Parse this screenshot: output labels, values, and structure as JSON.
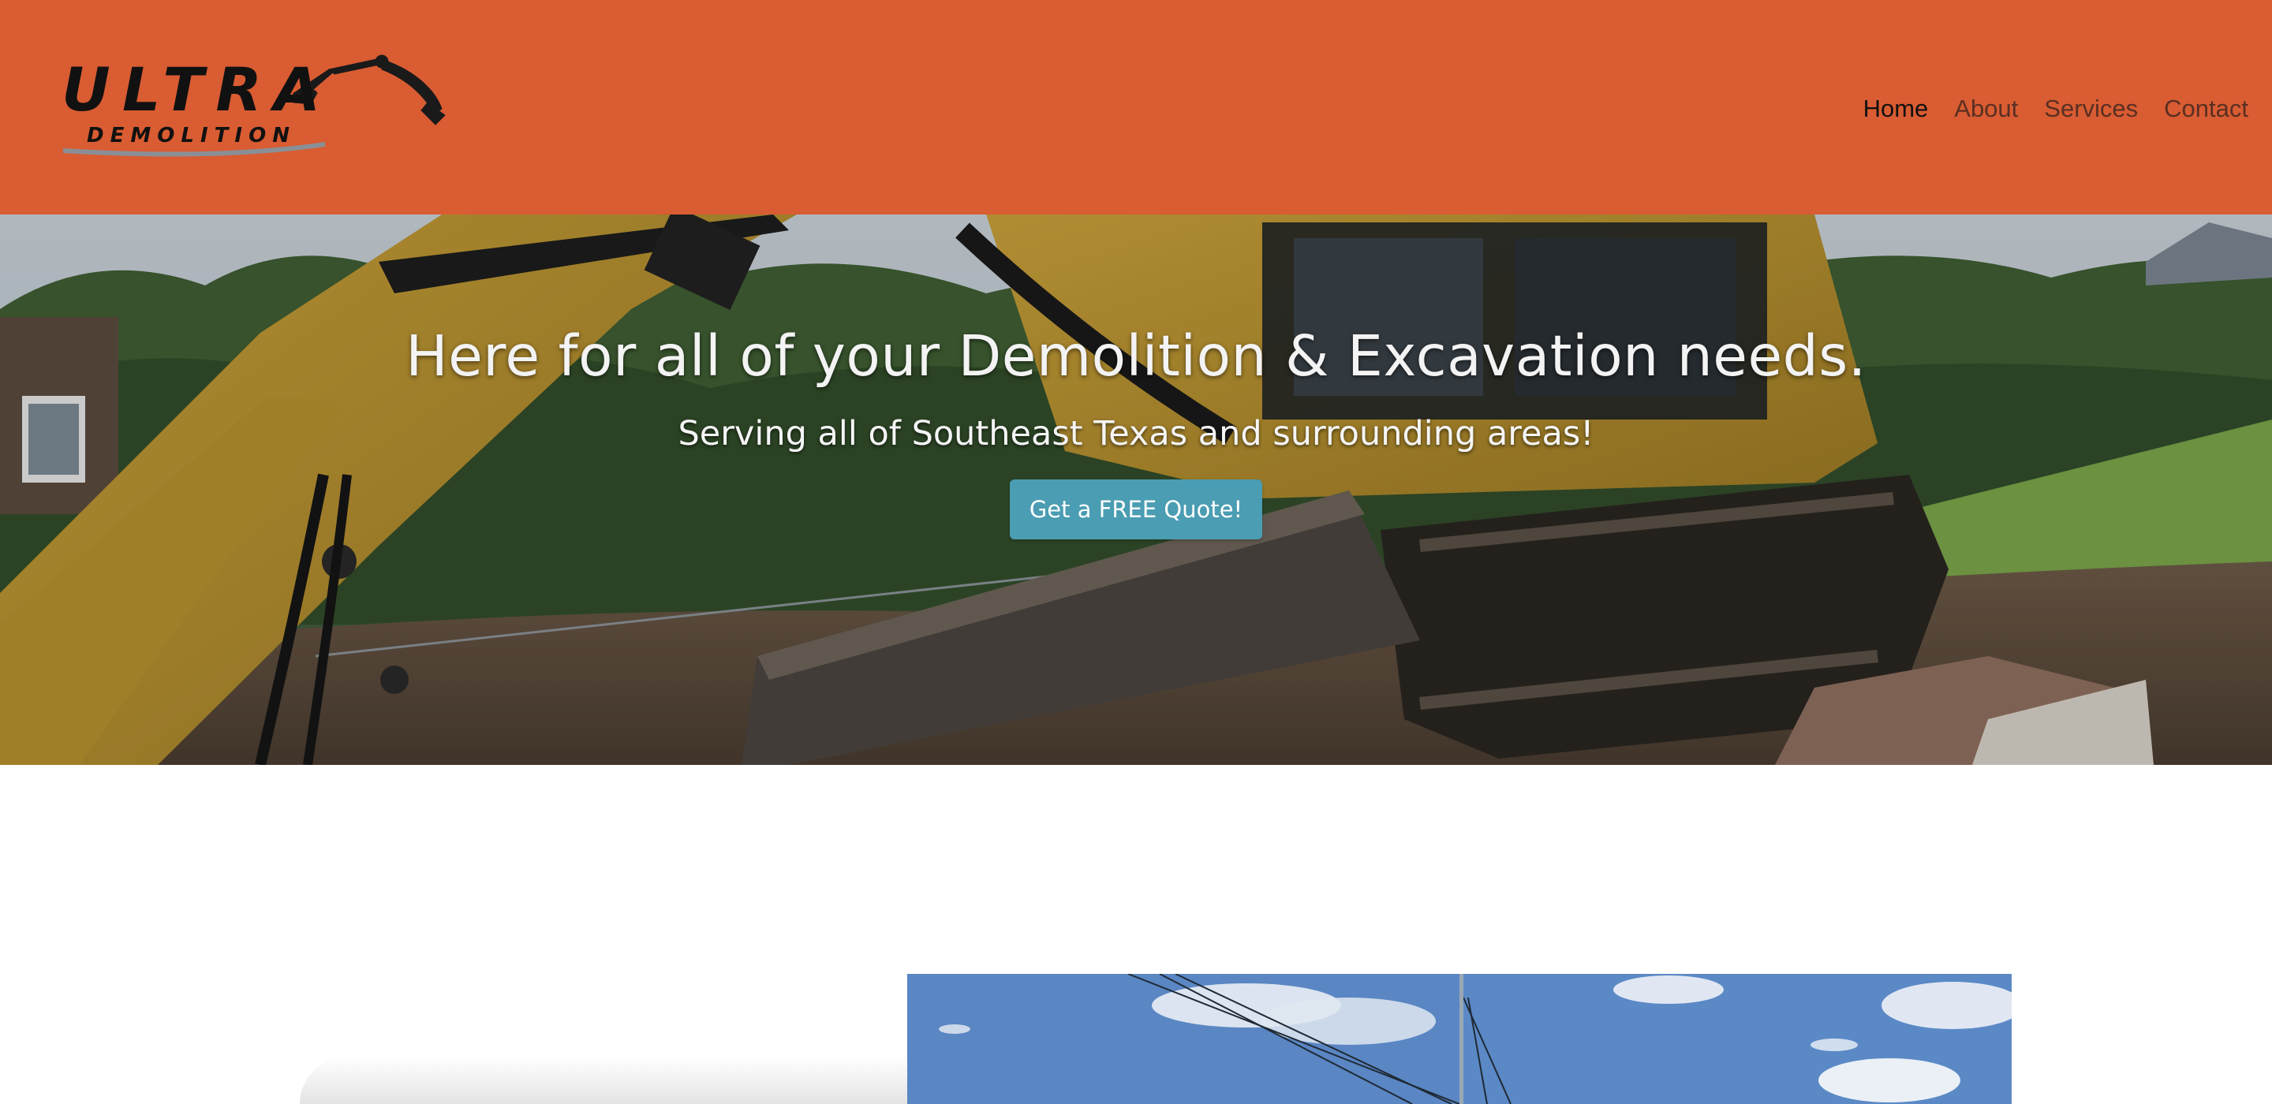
{
  "header": {
    "logo": {
      "icon": "excavator-logo",
      "wordmark": "ULTRA",
      "tagline": "DEMOLITION"
    },
    "nav": [
      {
        "label": "Home",
        "active": true
      },
      {
        "label": "About",
        "active": false
      },
      {
        "label": "Services",
        "active": false
      },
      {
        "label": "Contact",
        "active": false
      }
    ]
  },
  "hero": {
    "title": "Here for all of your Demolition & Excavation needs.",
    "subtitle": "Serving all of Southeast Texas and surrounding areas!",
    "cta_label": "Get a FREE Quote!",
    "background_image": "excavator-on-demolition-site-photo"
  },
  "gallery": [
    {
      "image": "sky-with-power-lines-photo"
    },
    {
      "image": "sky-with-clouds-photo"
    }
  ],
  "colors": {
    "header_bg": "#D95C32",
    "nav_text": "#5a2f22",
    "nav_active": "#111111",
    "cta_bg": "#4A9DB2",
    "cta_text": "#ffffff"
  }
}
